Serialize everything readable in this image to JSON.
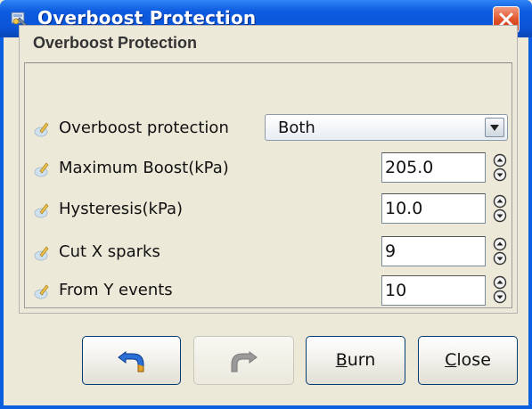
{
  "window": {
    "title": "Overboost Protection"
  },
  "group": {
    "title": "Overboost Protection"
  },
  "rows": [
    {
      "label": "Overboost protection",
      "value": "Both"
    },
    {
      "label": "Maximum Boost(kPa)",
      "value": "205.0"
    },
    {
      "label": "Hysteresis(kPa)",
      "value": "10.0"
    },
    {
      "label": "Cut X sparks",
      "value": "9"
    },
    {
      "label": "From Y events",
      "value": "10"
    }
  ],
  "buttons": {
    "undo_icon": "undo-arrow-icon",
    "redo_icon": "redo-arrow-icon",
    "burn": "Burn",
    "close": "Close"
  },
  "colors": {
    "titlebar": "#0a55d8",
    "close_button": "#e0532a",
    "dialog_bg": "#ece9d8"
  }
}
